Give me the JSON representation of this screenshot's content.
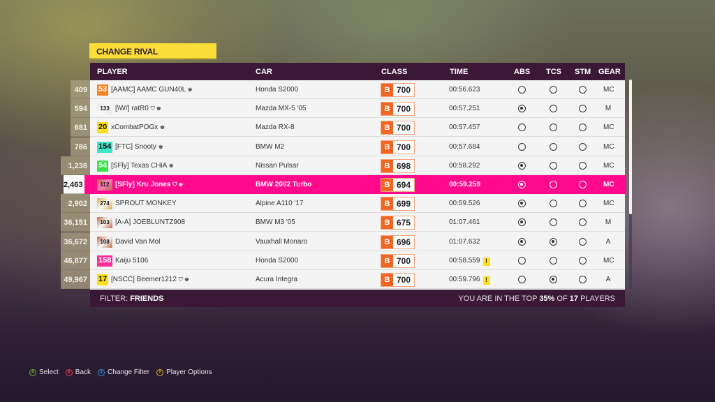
{
  "title": "CHANGE RIVAL",
  "columns": {
    "player": "PLAYER",
    "car": "CAR",
    "class": "CLASS",
    "time": "TIME",
    "abs": "ABS",
    "tcs": "TCS",
    "stm": "STM",
    "gear": "GEAR"
  },
  "rows": [
    {
      "rank": "409",
      "level": "53",
      "level_color": "#f58220",
      "level_style": "big",
      "player": "[AAMC] AAMC GUN40L",
      "icons": "♚",
      "car": "Honda S2000",
      "class_letter": "B",
      "class_pi": "700",
      "time": "00:56.623",
      "warning": "",
      "abs": false,
      "tcs": false,
      "stm": false,
      "gear": "MC"
    },
    {
      "rank": "594",
      "level": "133",
      "level_color": "#e6e8ec",
      "level_style": "small",
      "player": "[\\W/] ratR0",
      "icons": "⛉ ♚",
      "car": "Mazda MX-5 '05",
      "class_letter": "B",
      "class_pi": "700",
      "time": "00:57.251",
      "warning": "",
      "abs": true,
      "tcs": false,
      "stm": false,
      "gear": "M"
    },
    {
      "rank": "681",
      "level": "20",
      "level_color": "#ffe01a",
      "level_style": "big",
      "player": "xCombatPOGx",
      "icons": "♚",
      "car": "Mazda RX-8",
      "class_letter": "B",
      "class_pi": "700",
      "time": "00:57.457",
      "warning": "",
      "abs": false,
      "tcs": false,
      "stm": false,
      "gear": "MC"
    },
    {
      "rank": "786",
      "level": "154",
      "level_color": "#3de6c8",
      "level_style": "big",
      "player": "[FTC] Snooty",
      "icons": "♚",
      "car": "BMW M2",
      "class_letter": "B",
      "class_pi": "700",
      "time": "00:57.684",
      "warning": "",
      "abs": false,
      "tcs": false,
      "stm": false,
      "gear": "MC"
    },
    {
      "rank": "1,238",
      "level": "54",
      "level_color": "#3ae04a",
      "level_style": "big",
      "player": "[SFly] Texas CHiA",
      "icons": "♚",
      "car": "Nissan Pulsar",
      "class_letter": "B",
      "class_pi": "698",
      "time": "00:58.292",
      "warning": "",
      "abs": true,
      "tcs": false,
      "stm": false,
      "gear": "MC"
    },
    {
      "rank": "2,463",
      "level": "112",
      "level_color": "#b8673e",
      "level_style": "small",
      "player": "[SFly] Kru Jones",
      "icons": "⛉ ♚",
      "car": "BMW 2002 Turbo",
      "class_letter": "B",
      "class_pi": "694",
      "time": "00:59.259",
      "warning": "",
      "abs": true,
      "tcs": false,
      "stm": false,
      "gear": "MC",
      "highlighted": true
    },
    {
      "rank": "2,902",
      "level": "274",
      "level_color": "#d8b04a",
      "level_style": "small",
      "player": "SPROUT MONKEY",
      "icons": "",
      "car": "Alpine A110 '17",
      "class_letter": "B",
      "class_pi": "699",
      "time": "00:59.526",
      "warning": "",
      "abs": true,
      "tcs": false,
      "stm": false,
      "gear": "MC"
    },
    {
      "rank": "36,151",
      "level": "103",
      "level_color": "#c06a45",
      "level_style": "small",
      "player": "[A-A] JOEBLUNTZ908",
      "icons": "",
      "car": "BMW M3 '05",
      "class_letter": "B",
      "class_pi": "675",
      "time": "01:07.461",
      "warning": "",
      "abs": true,
      "tcs": false,
      "stm": false,
      "gear": "M"
    },
    {
      "rank": "36,672",
      "level": "108",
      "level_color": "#c06a45",
      "level_style": "small",
      "player": "David Van Mol",
      "icons": "",
      "car": "Vauxhall Monaro",
      "class_letter": "B",
      "class_pi": "696",
      "time": "01:07.632",
      "warning": "",
      "abs": true,
      "tcs": true,
      "stm": false,
      "gear": "A"
    },
    {
      "rank": "46,877",
      "level": "158",
      "level_color": "#ff2e9a",
      "level_style": "big",
      "player": "Kaiju 5106",
      "icons": "",
      "car": "Honda S2000",
      "class_letter": "B",
      "class_pi": "700",
      "time": "00:58.559",
      "warning": "!",
      "abs": false,
      "tcs": false,
      "stm": false,
      "gear": "MC"
    },
    {
      "rank": "49,967",
      "level": "17",
      "level_color": "#ffe01a",
      "level_style": "big",
      "player": "[NSCC] Beemer1212",
      "icons": "⛉ ♚",
      "car": "Acura Integra",
      "class_letter": "B",
      "class_pi": "700",
      "time": "00:59.796",
      "warning": "!",
      "abs": false,
      "tcs": true,
      "stm": false,
      "gear": "A"
    }
  ],
  "footer": {
    "filter_label": "FILTER:",
    "filter_value": "FRIENDS",
    "summary_prefix": "YOU ARE IN THE TOP",
    "summary_percent": "35%",
    "summary_mid": "OF",
    "summary_count": "17",
    "summary_suffix": "PLAYERS"
  },
  "hints": [
    {
      "button": "A",
      "label": "Select",
      "color": "#5fbf3a"
    },
    {
      "button": "B",
      "label": "Back",
      "color": "#e0395a"
    },
    {
      "button": "X",
      "label": "Change Filter",
      "color": "#3a8fe0"
    },
    {
      "button": "Y",
      "label": "Player Options",
      "color": "#e0b22a"
    }
  ],
  "colors": {
    "highlight": "#ff0a8c",
    "header_bg": "#3a1836",
    "title_bg": "#fbdd3a",
    "class_b": "#f26522"
  }
}
